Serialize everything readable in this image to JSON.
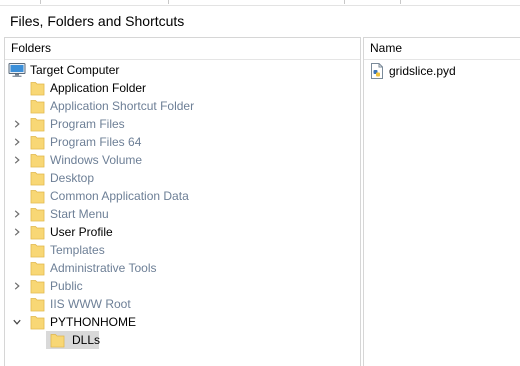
{
  "header": {
    "title": "Files, Folders and Shortcuts"
  },
  "folders_pane": {
    "column_header": "Folders",
    "root": {
      "label": "Target Computer",
      "icon": "computer-icon"
    },
    "items": [
      {
        "label": "Application Folder",
        "state": "bright",
        "expander": "none",
        "icon": "folder-icon"
      },
      {
        "label": "Application Shortcut Folder",
        "state": "dim",
        "expander": "none",
        "icon": "folder-icon"
      },
      {
        "label": "Program Files",
        "state": "dim",
        "expander": "collapsed",
        "icon": "folder-icon"
      },
      {
        "label": "Program Files 64",
        "state": "dim",
        "expander": "collapsed",
        "icon": "folder-icon"
      },
      {
        "label": "Windows Volume",
        "state": "dim",
        "expander": "collapsed",
        "icon": "folder-icon"
      },
      {
        "label": "Desktop",
        "state": "dim",
        "expander": "none",
        "icon": "folder-icon"
      },
      {
        "label": "Common Application Data",
        "state": "dim",
        "expander": "none",
        "icon": "folder-icon"
      },
      {
        "label": "Start Menu",
        "state": "dim",
        "expander": "collapsed",
        "icon": "folder-icon"
      },
      {
        "label": "User Profile",
        "state": "bright",
        "expander": "collapsed",
        "icon": "folder-icon"
      },
      {
        "label": "Templates",
        "state": "dim",
        "expander": "none",
        "icon": "folder-icon"
      },
      {
        "label": "Administrative Tools",
        "state": "dim",
        "expander": "none",
        "icon": "folder-icon"
      },
      {
        "label": "Public",
        "state": "dim",
        "expander": "collapsed",
        "icon": "folder-icon"
      },
      {
        "label": "IIS WWW Root",
        "state": "dim",
        "expander": "none",
        "icon": "folder-icon"
      },
      {
        "label": "PYTHONHOME",
        "state": "bright",
        "expander": "expanded",
        "icon": "folder-icon"
      }
    ],
    "child": {
      "label": "DLLs",
      "state": "bright",
      "selected": true,
      "icon": "folder-icon"
    }
  },
  "files_pane": {
    "column_header": "Name",
    "files": [
      {
        "label": "gridslice.pyd",
        "icon": "python-file-icon"
      }
    ]
  },
  "colors": {
    "folder_fill": "#f8d775",
    "folder_edge": "#e0b64a",
    "dim_text": "#6d7f96",
    "selection": "#d9d9d9",
    "computer_screen": "#3b8fd9"
  }
}
